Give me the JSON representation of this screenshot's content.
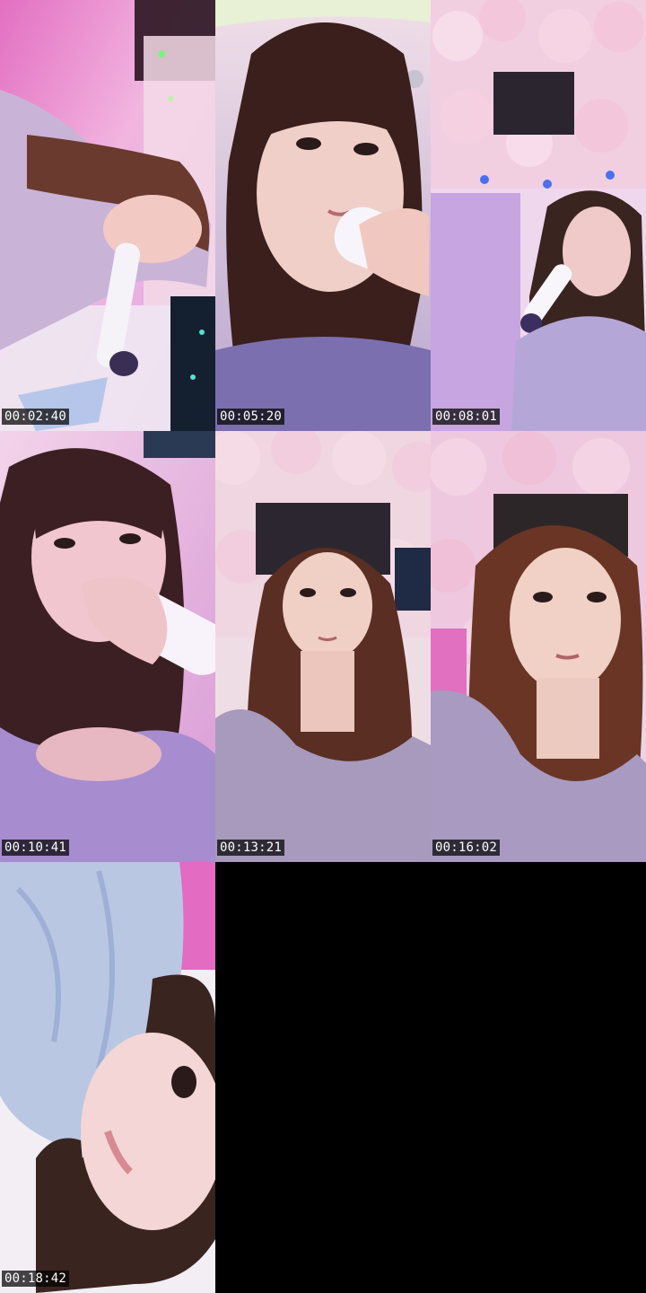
{
  "layout": {
    "columns": 3,
    "rows": 3
  },
  "frames": [
    {
      "timestamp": "00:02:40",
      "scene": "singer-with-microphone-tilted"
    },
    {
      "timestamp": "00:05:20",
      "scene": "singer-closeup-with-microphone"
    },
    {
      "timestamp": "00:08:01",
      "scene": "singer-under-flower-ceiling"
    },
    {
      "timestamp": "00:10:41",
      "scene": "singer-holding-microphone"
    },
    {
      "timestamp": "00:13:21",
      "scene": "singer-under-flower-ceiling"
    },
    {
      "timestamp": "00:16:02",
      "scene": "singer-under-flower-ceiling"
    },
    {
      "timestamp": "00:18:42",
      "scene": "singer-face-with-tulle-fabric"
    }
  ],
  "colors": {
    "background": "#000000",
    "stamp_bg": "#000000",
    "stamp_text": "#ffffff"
  }
}
